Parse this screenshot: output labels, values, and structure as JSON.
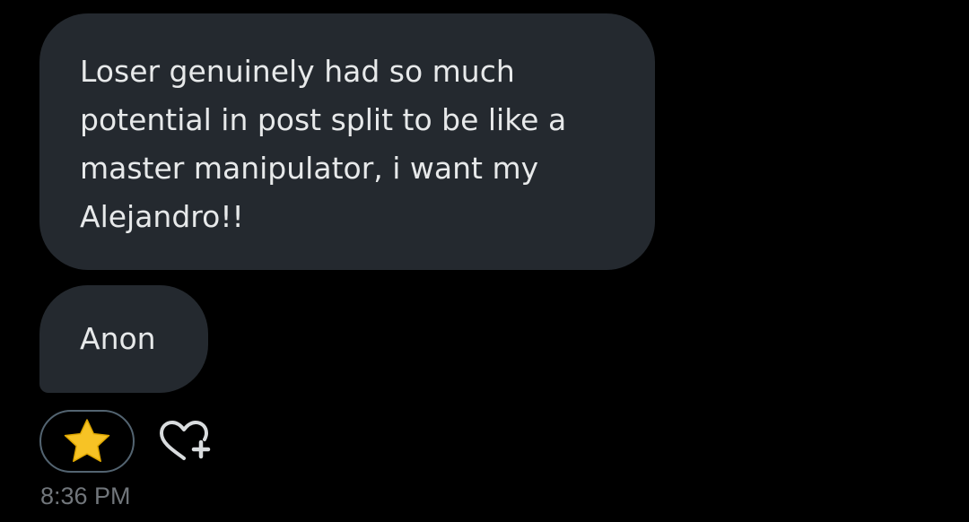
{
  "messages": [
    {
      "text": "Loser genuinely had so much potential in post split to be like a master manipulator, i want my Alejandro!!"
    },
    {
      "text": "Anon"
    }
  ],
  "reactions": {
    "emoji_icon": "star-icon",
    "add_icon": "heart-plus-icon"
  },
  "timestamp": "8:36 PM",
  "colors": {
    "background": "#000000",
    "bubble": "#24292f",
    "text": "#e7e9ea",
    "muted": "#71767b",
    "star": "#f7c325"
  }
}
